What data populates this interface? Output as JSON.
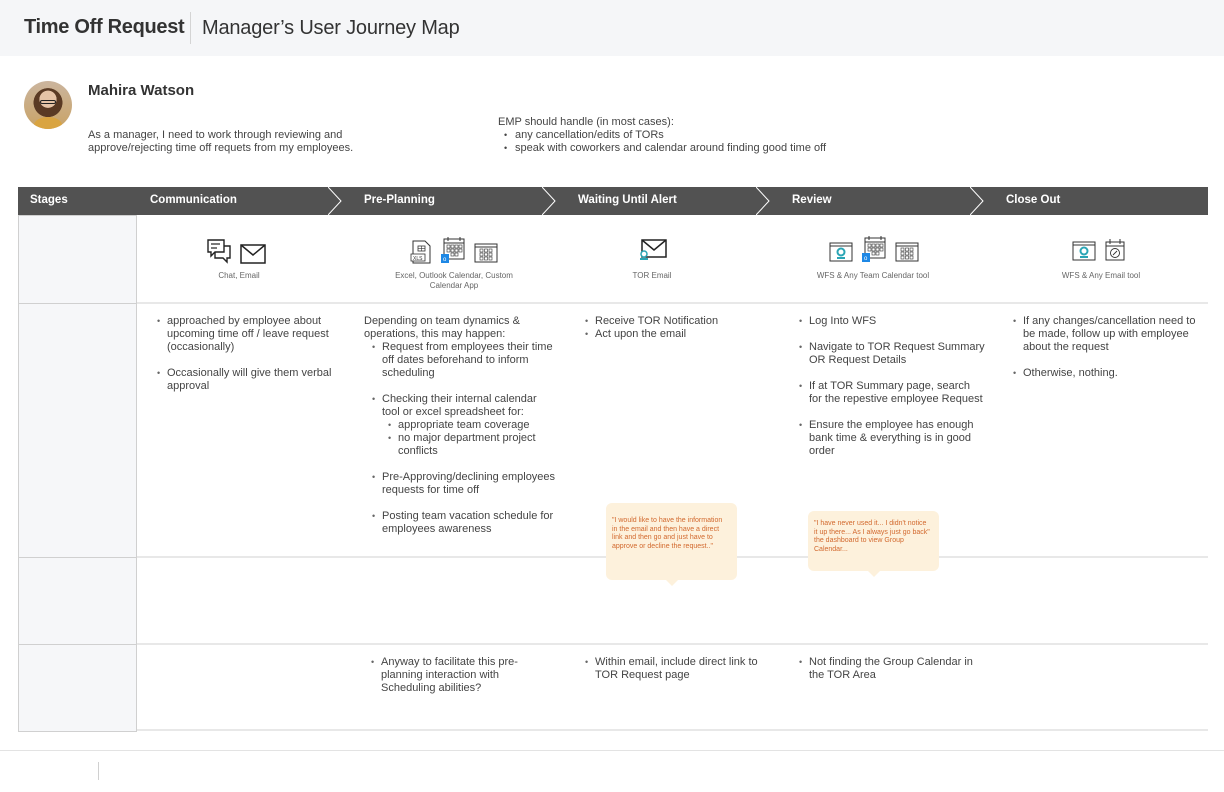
{
  "header": {
    "title": "Time Off Request",
    "subtitle": "Manager’s User Journey Map"
  },
  "persona": {
    "name": "Mahira Watson",
    "description": "As a manager, I need to work through reviewing and approve/rejecting time off requets from my employees.",
    "avatar": "persona-photo"
  },
  "notes": {
    "heading": "EMP should handle (in most cases):",
    "items": [
      "any cancellation/edits of TORs",
      "speak with coworkers and calendar around finding good time off"
    ]
  },
  "stages_header": "Stages",
  "stages": [
    {
      "name": "Communication",
      "tools_label": "Chat, Email",
      "icons": [
        "chat-icon",
        "email-icon"
      ],
      "actions": [
        "approached by employee about upcoming time off / leave request (occasionally)",
        "Occasionally will give them verbal approval"
      ],
      "opportunities": []
    },
    {
      "name": "Pre-Planning",
      "tools_label": "Excel, Outlook Calendar, Custom Calendar App",
      "icons": [
        "excel-file-icon",
        "outlook-calendar-icon",
        "custom-calendar-app-icon"
      ],
      "actions_intro": "Depending on team dynamics & operations, this may happen:",
      "actions": [
        "Request from employees their time off dates beforehand to inform scheduling",
        "Checking their internal calendar tool or excel spreadsheet for:",
        "Pre-Approving/declining employees requests for time off",
        "Posting team vacation schedule for employees awareness"
      ],
      "sub_actions": [
        "appropriate team coverage",
        "no major department project conflicts"
      ],
      "opportunities": [
        "Anyway to facilitate this pre-planning interaction with Scheduling abilities?"
      ]
    },
    {
      "name": "Waiting Until Alert",
      "tools_label": "TOR Email",
      "icons": [
        "tor-email-icon"
      ],
      "actions": [
        "Receive TOR Notification",
        "Act upon the email"
      ],
      "quote": "\"I would like to have the information in the email and then have a direct link and then go and just have to approve or decline the request..\"",
      "opportunities": [
        "Within email, include direct link to TOR Request page"
      ]
    },
    {
      "name": "Review",
      "tools_label": "WFS & Any Team Calendar tool",
      "icons": [
        "wfs-app-icon",
        "outlook-calendar-icon",
        "custom-calendar-app-icon"
      ],
      "actions": [
        "Log Into WFS",
        "Navigate to TOR Request Summary OR  Request Details",
        "If at TOR Summary page, search for the repestive employee Request",
        "Ensure the employee has enough bank time & everything is in good order"
      ],
      "quote": "\"I have never used it... I didn't notice it up there... As I always just go back\" the dashboard to view Group Calendar...",
      "opportunities": [
        "Not finding the Group Calendar in the TOR Area"
      ]
    },
    {
      "name": "Close Out",
      "tools_label": "WFS & Any Email tool",
      "icons": [
        "wfs-app-icon",
        "calendar-clock-icon"
      ],
      "actions": [
        "If any changes/cancellation need to be made, follow up with employee about the request",
        "Otherwise, nothing."
      ],
      "opportunities": []
    }
  ],
  "colors": {
    "stage_bar": "#525252",
    "quote_bg": "#fdf1dc",
    "quote_text": "#d2692e",
    "wfs_accent": "#2aa5b5",
    "outlook_blue": "#1e88e5"
  }
}
